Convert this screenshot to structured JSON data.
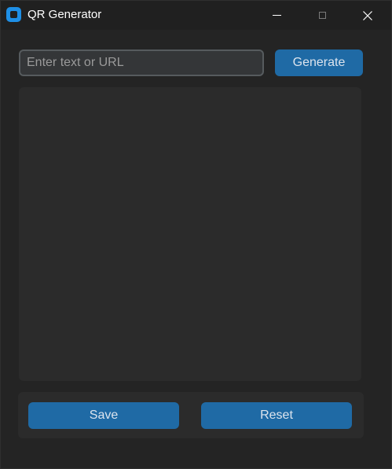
{
  "window": {
    "title": "QR Generator",
    "icon": "app-icon",
    "controls": {
      "minimize": "minimize-icon",
      "maximize": "maximize-icon",
      "close": "close-icon"
    }
  },
  "input": {
    "value": "",
    "placeholder": "Enter text or URL"
  },
  "buttons": {
    "generate": "Generate",
    "save": "Save",
    "reset": "Reset"
  },
  "colors": {
    "accent": "#1f6aa5",
    "background": "#242424",
    "panel": "#2b2b2b",
    "app_icon": "#1e8fe6"
  }
}
